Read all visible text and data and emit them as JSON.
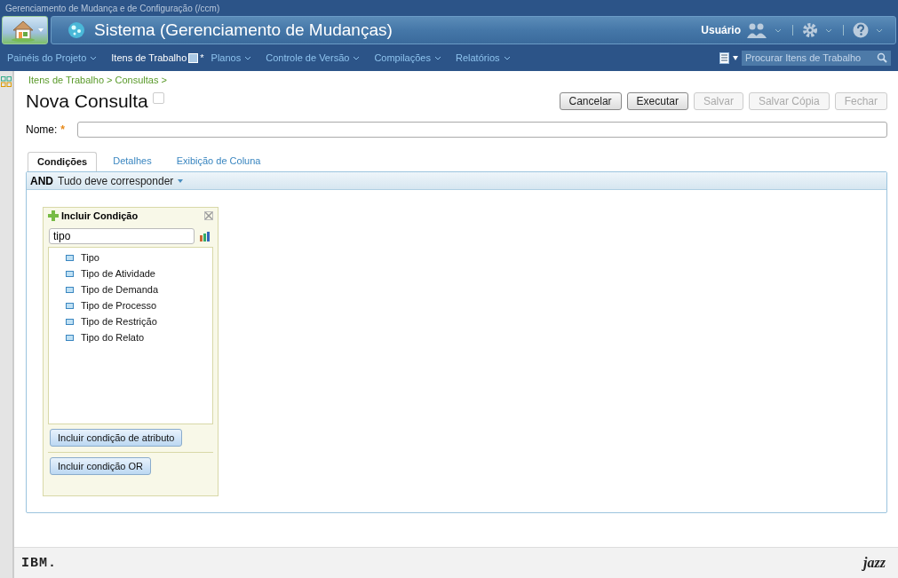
{
  "app_title": "Gerenciamento de Mudança e de Configuração (/ccm)",
  "banner": {
    "title": "Sistema (Gerenciamento de Mudanças)",
    "user": "Usuário"
  },
  "nav": [
    {
      "label": "Painéis do Projeto",
      "selected": false
    },
    {
      "label": "Itens de Trabalho",
      "selected": true,
      "mark": "*"
    },
    {
      "label": "Planos",
      "selected": false
    },
    {
      "label": "Controle de Versão",
      "selected": false
    },
    {
      "label": "Compilações",
      "selected": false
    },
    {
      "label": "Relatórios",
      "selected": false
    }
  ],
  "search": {
    "placeholder": "Procurar Itens de Trabalho"
  },
  "breadcrumb": "Itens de Trabalho > Consultas >",
  "page_title": "Nova Consulta",
  "buttons": [
    {
      "label": "Cancelar",
      "disabled": false
    },
    {
      "label": "Executar",
      "disabled": false
    },
    {
      "label": "Salvar",
      "disabled": true
    },
    {
      "label": "Salvar Cópia",
      "disabled": true
    },
    {
      "label": "Fechar",
      "disabled": true
    }
  ],
  "name_field": {
    "label": "Nome:",
    "required_mark": "*"
  },
  "tabs": [
    {
      "label": "Condições",
      "selected": true
    },
    {
      "label": "Detalhes",
      "selected": false
    },
    {
      "label": "Exibição de Coluna",
      "selected": false
    }
  ],
  "condition_header": {
    "operator": "AND",
    "mode": "Tudo deve corresponder"
  },
  "add_condition": {
    "title": "Incluir Condição",
    "filter": "tipo",
    "attributes": [
      "Tipo",
      "Tipo de Atividade",
      "Tipo de Demanda",
      "Tipo de Processo",
      "Tipo de Restrição",
      "Tipo do Relato"
    ],
    "buttons": [
      "Incluir condição de atributo",
      "Incluir condição OR"
    ]
  },
  "footer": {
    "left_logo": "IBM.",
    "right_logo": "jazz"
  }
}
